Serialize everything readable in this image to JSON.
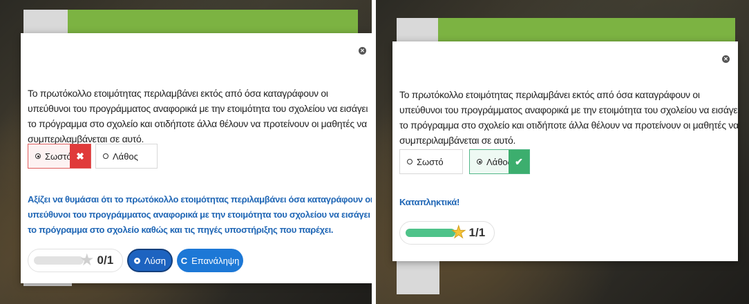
{
  "colors": {
    "accent_blue": "#1d63c0",
    "feedback_blue": "#1f66b5",
    "wrong_red": "#e03a3a",
    "correct_green": "#3cae6e",
    "progress_green": "#4fc38a",
    "star_gold": "#f6c43a"
  },
  "left": {
    "question": "Το πρωτόκολλο ετοιμότητας περιλαμβάνει εκτός από όσα καταγράφουν οι υπεύθυνοι του προγράμματος αναφορικά με την ετοιμότητα του σχολείου να εισάγει το πρόγραμμα στο σχολείο και οτιδήποτε άλλα θέλουν να προτείνουν οι μαθητές να συμπεριλαμβάνεται σε αυτό.",
    "answer_true": "Σωστό",
    "answer_false": "Λάθος",
    "true_mark": "✖",
    "true_state": "selected-wrong",
    "feedback": "Αξίζει να θυμάσαι ότι το πρωτόκολλο ετοιμότητας περιλαμβάνει όσα καταγράφουν οι υπεύθυνοι του προγράμματος αναφορικά με την ετοιμότητα του σχολείου να εισάγει το πρόγραμμα στο σχολείο καθώς και τις πηγές υποστήριξης που παρέχει.",
    "score_text": "0/1",
    "score_fraction": 0,
    "star_icon": "star-empty-icon",
    "solution_label": "Λύση",
    "retry_label": "Επανάληψη",
    "retry_icon": "C"
  },
  "right": {
    "question": "Το πρωτόκολλο ετοιμότητας περιλαμβάνει εκτός από όσα καταγράφουν οι υπεύθυνοι του προγράμματος αναφορικά με την ετοιμότητα του σχολείου να εισάγει το πρόγραμμα στο σχολείο και οτιδήποτε άλλα θέλουν να προτείνουν οι μαθητές να συμπεριλαμβάνεται σε αυτό.",
    "answer_true": "Σωστό",
    "answer_false": "Λάθος",
    "false_mark": "✔",
    "false_state": "selected-correct",
    "feedback": "Καταπληκτικά!",
    "score_text": "1/1",
    "score_fraction": 1,
    "star_icon": "star-full-icon"
  },
  "close_glyph": "✕"
}
